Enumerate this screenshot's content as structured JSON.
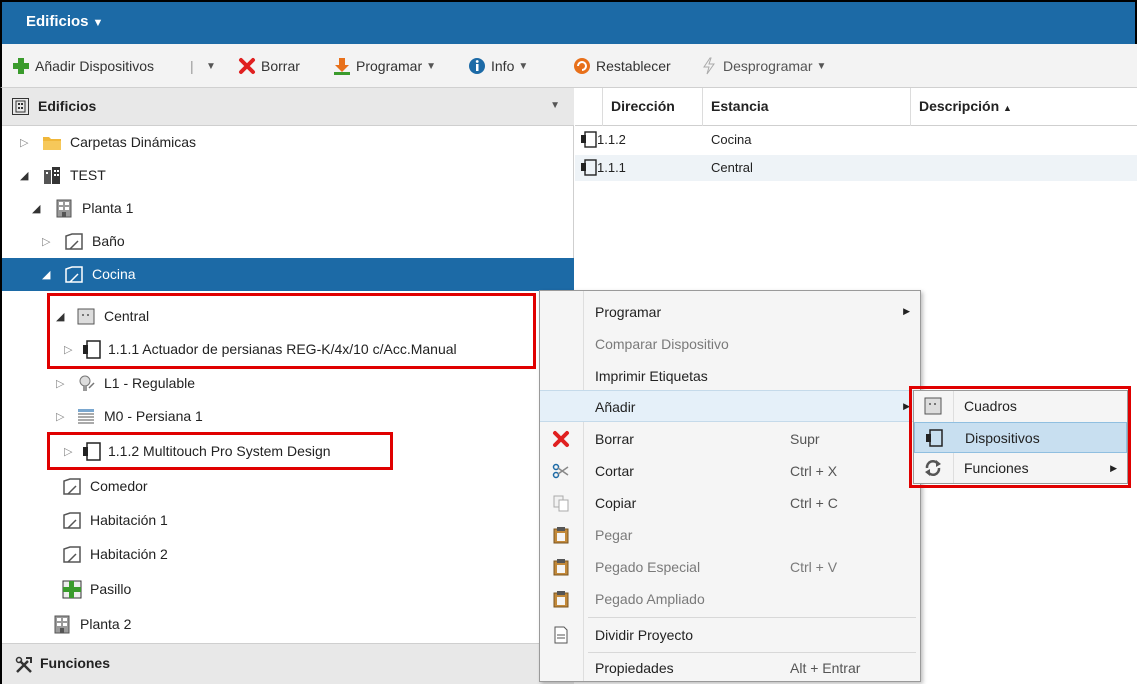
{
  "titlebar": {
    "title": "Edificios",
    "caret": "▼"
  },
  "toolbar": {
    "add_devices": "Añadir Dispositivos",
    "delete": "Borrar",
    "program": "Programar",
    "info": "Info",
    "reset": "Restablecer",
    "unprogram": "Desprogramar",
    "dropdown": "▼"
  },
  "tree": {
    "header": "Edificios",
    "items": [
      {
        "label": "Carpetas Dinámicas"
      },
      {
        "label": "TEST"
      },
      {
        "label": "Planta 1"
      },
      {
        "label": "Baño"
      },
      {
        "label": "Cocina"
      },
      {
        "label": "Central"
      },
      {
        "label": "1.1.1 Actuador de persianas REG-K/4x/10 c/Acc.Manual"
      },
      {
        "label": "L1 - Regulable"
      },
      {
        "label": "M0 - Persiana 1"
      },
      {
        "label": "1.1.2 Multitouch Pro System Design"
      },
      {
        "label": "Comedor"
      },
      {
        "label": "Habitación 1"
      },
      {
        "label": "Habitación 2"
      },
      {
        "label": "Pasillo"
      },
      {
        "label": "Planta 2"
      }
    ],
    "functions": "Funciones"
  },
  "grid": {
    "headers": {
      "address": "Dirección",
      "room": "Estancia",
      "description": "Descripción",
      "sort": "▲"
    },
    "rows": [
      {
        "address": "1.1.2",
        "room": "Cocina",
        "description": ""
      },
      {
        "address": "1.1.1",
        "room": "Central",
        "description": ""
      }
    ]
  },
  "context_menu": {
    "items": [
      {
        "label": "Programar",
        "shortcut": ""
      },
      {
        "label": "Comparar Dispositivo",
        "shortcut": ""
      },
      {
        "label": "Imprimir Etiquetas",
        "shortcut": ""
      },
      {
        "label": "Añadir",
        "shortcut": ""
      },
      {
        "label": "Borrar",
        "shortcut": "Supr"
      },
      {
        "label": "Cortar",
        "shortcut": "Ctrl + X"
      },
      {
        "label": "Copiar",
        "shortcut": "Ctrl + C"
      },
      {
        "label": "Pegar",
        "shortcut": ""
      },
      {
        "label": "Pegado Especial",
        "shortcut": "Ctrl + V"
      },
      {
        "label": "Pegado Ampliado",
        "shortcut": ""
      },
      {
        "label": "Dividir Proyecto",
        "shortcut": ""
      },
      {
        "label": "Propiedades",
        "shortcut": "Alt + Entrar"
      }
    ]
  },
  "submenu": {
    "items": [
      {
        "label": "Cuadros"
      },
      {
        "label": "Dispositivos"
      },
      {
        "label": "Funciones"
      }
    ]
  },
  "colors": {
    "accent": "#1c6aa6",
    "highlight_box": "#e00000",
    "menu_hover": "#c8dff0"
  }
}
